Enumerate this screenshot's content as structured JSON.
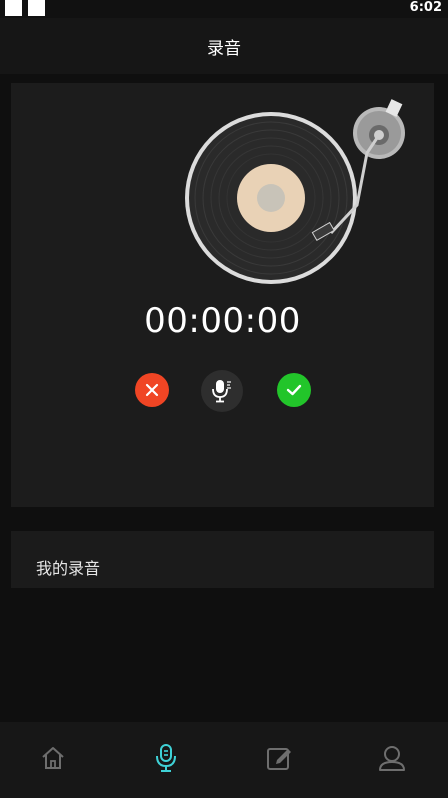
{
  "status_bar": {
    "time": "6:02"
  },
  "header": {
    "title": "录音"
  },
  "recorder": {
    "timer": "00:00:00",
    "cancel_icon": "close-icon",
    "mic_icon": "microphone-icon",
    "confirm_icon": "check-icon"
  },
  "my_recordings": {
    "label": "我的录音"
  },
  "tab_bar": {
    "items": [
      {
        "icon": "home-icon",
        "active": false
      },
      {
        "icon": "microphone-icon",
        "active": true
      },
      {
        "icon": "edit-icon",
        "active": false
      },
      {
        "icon": "user-icon",
        "active": false
      }
    ],
    "active_color": "#3fd1d6",
    "inactive_color": "#6e6e6e"
  },
  "colors": {
    "cancel": "#f04524",
    "confirm": "#22c52a",
    "background": "#0f0f0f",
    "card": "#1c1c1c"
  }
}
